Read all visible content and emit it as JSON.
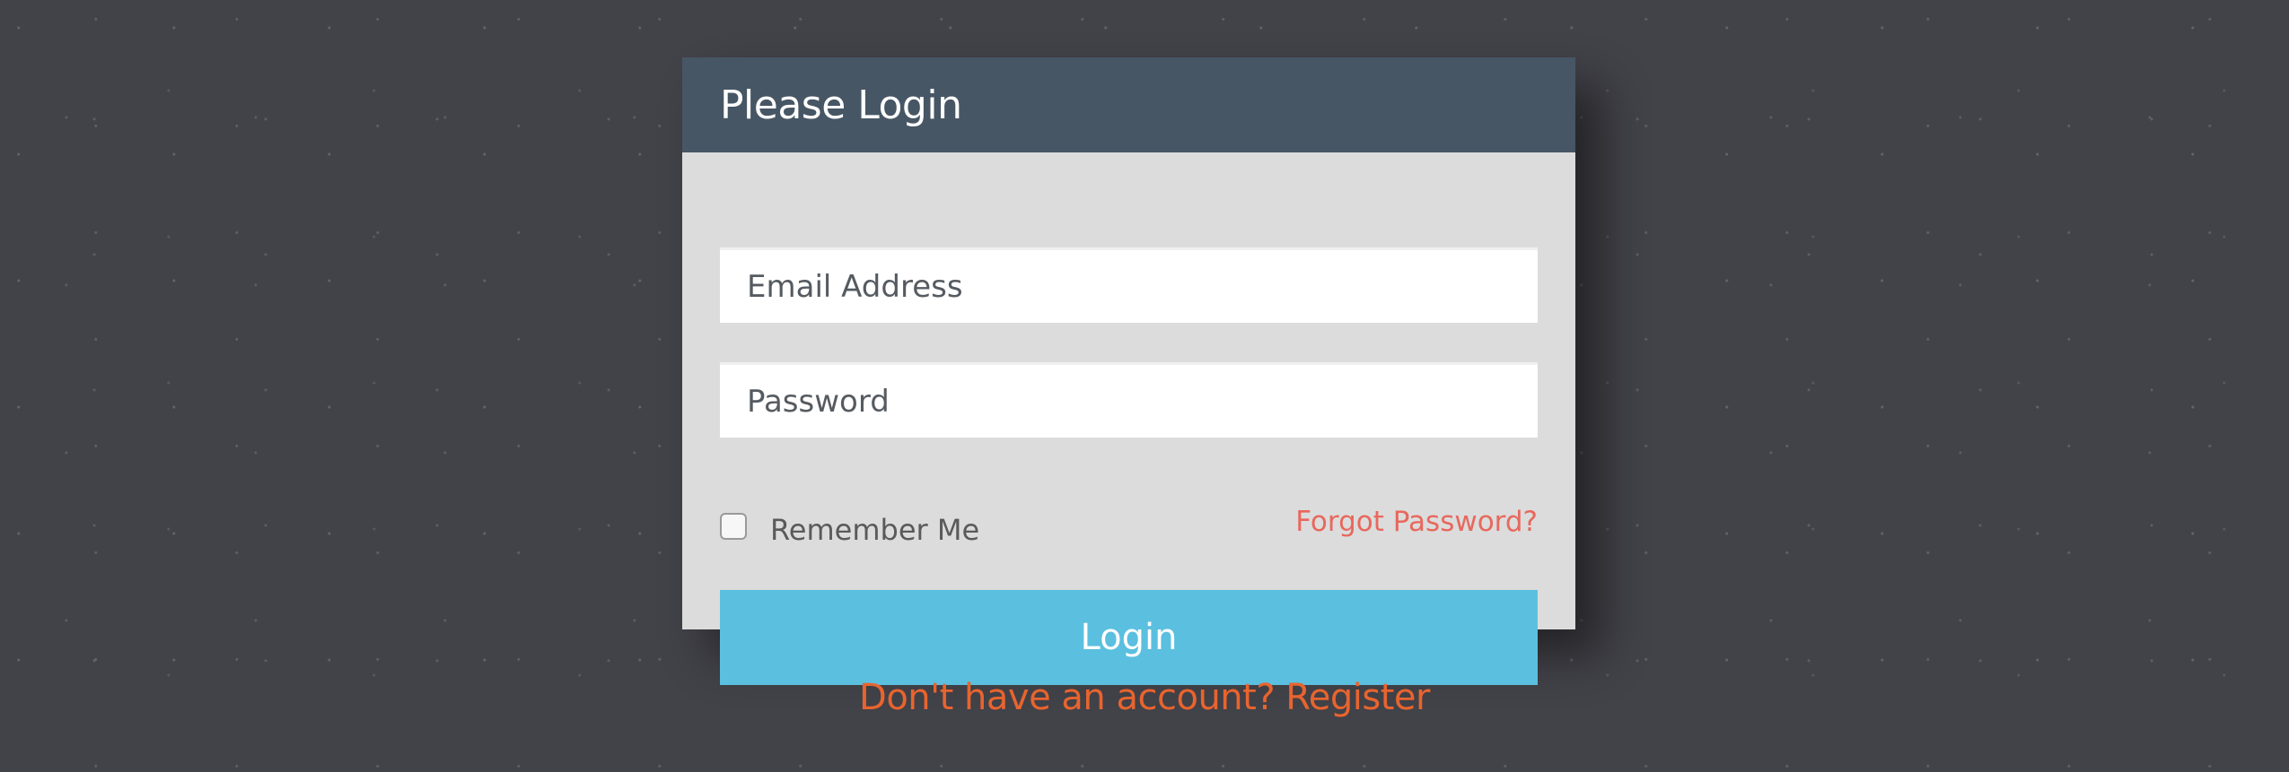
{
  "panel": {
    "title": "Please Login"
  },
  "form": {
    "email_placeholder": "Email Address",
    "password_placeholder": "Password",
    "remember_label": "Remember Me",
    "remember_checked": false,
    "forgot_label": "Forgot Password?",
    "login_label": "Login"
  },
  "footer": {
    "register_text": "Don't have an account? Register"
  },
  "colors": {
    "background": "#424249",
    "panel_header": "#475665",
    "panel_body": "#dcdcdc",
    "login_button": "#5bbfdf",
    "forgot_link": "#e8685d",
    "register_link": "#e8642e"
  }
}
